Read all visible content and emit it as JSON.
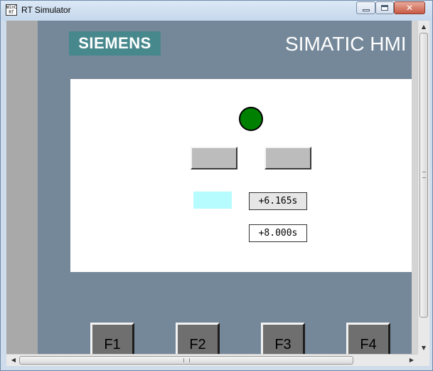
{
  "window": {
    "title": "RT Simulator",
    "icon_text": "WinCC RT",
    "close_glyph": "✕"
  },
  "header": {
    "logo_text": "SIEMENS",
    "product_name": "SIMATIC HMI"
  },
  "screen": {
    "lamp_color": "#008000",
    "indicator_color": "#b6fbfe",
    "io_field_1_value": "+6.165s",
    "io_field_2_value": "+8.000s"
  },
  "function_keys": [
    "F1",
    "F2",
    "F3",
    "F4"
  ],
  "scrollbars": {
    "up_arrow": "▲",
    "down_arrow": "▼",
    "left_arrow": "◀",
    "right_arrow": "▶"
  },
  "colors": {
    "panel_background": "#75889a",
    "logo_background": "#47888c"
  }
}
